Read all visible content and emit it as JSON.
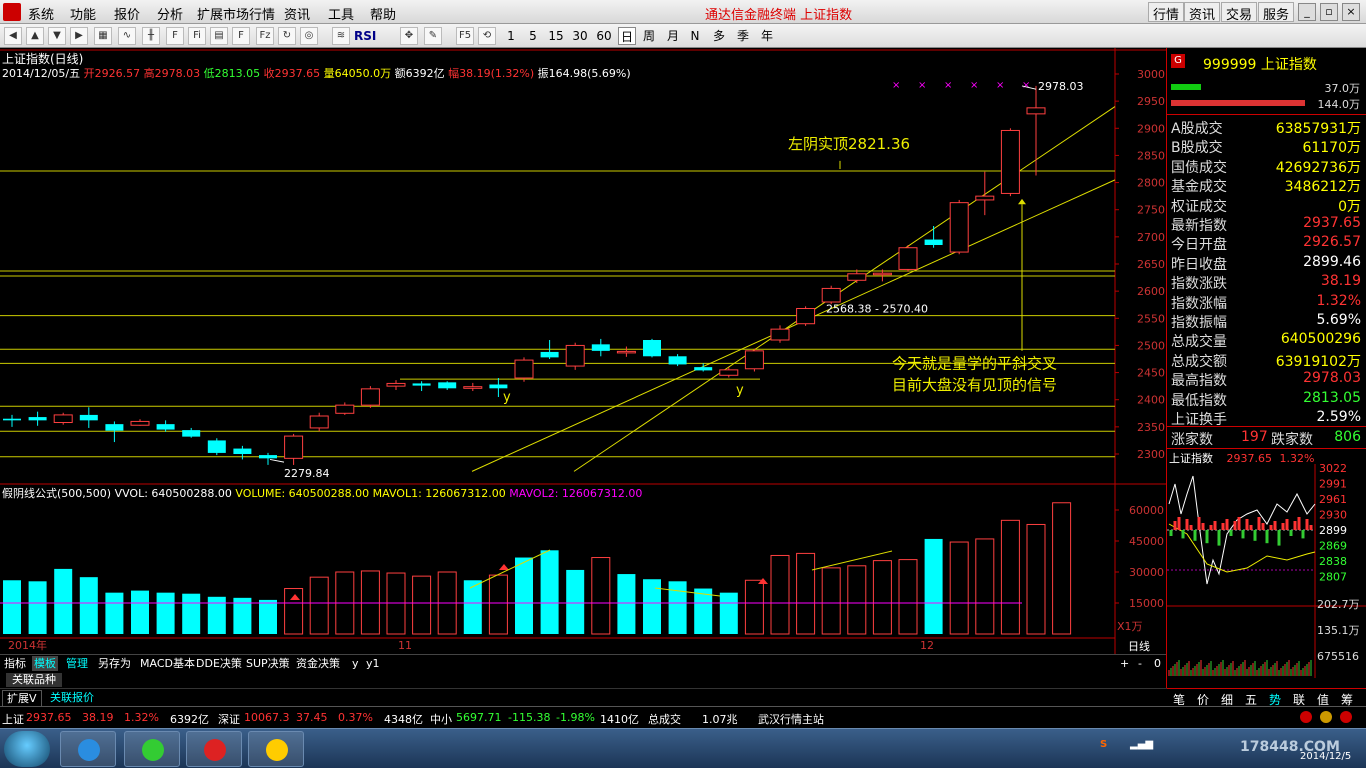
{
  "menu": {
    "items": [
      "系统",
      "功能",
      "报价",
      "分析",
      "扩展市场行情",
      "资讯",
      "工具",
      "帮助"
    ],
    "title": "通达信金融终端   上证指数",
    "right_buttons": [
      "行情",
      "资讯",
      "交易",
      "服务"
    ]
  },
  "toolbar": {
    "periods": [
      "1",
      "5",
      "15",
      "30",
      "60",
      "日",
      "周",
      "月",
      "N",
      "多",
      "季",
      "年"
    ],
    "active_period": "日",
    "indicator_label": "RSI"
  },
  "chart_info": {
    "title": "上证指数(日线)",
    "date": "2014/12/05/五",
    "open_label": "开",
    "open": "2926.57",
    "high_label": "高",
    "high": "2978.03",
    "low_label": "低",
    "low": "2813.05",
    "close_label": "收",
    "close": "2937.65",
    "vol_label": "量",
    "vol": "64050.0万",
    "amount_label": "额",
    "amount": "6392亿",
    "change_label": "幅",
    "change": "38.19(1.32%)",
    "amp_label": "振",
    "amp": "164.98(5.69%)"
  },
  "annotations": {
    "top_label": "左阴实顶2821.36",
    "range_label": "2568.38 - 2570.40",
    "low_label": "2279.84",
    "high_label": "2978.03",
    "msg1": "今天就是量学的平斜交叉",
    "msg2": "目前大盘没有见顶的信号",
    "y1": "y",
    "y2": "y"
  },
  "volume_info": {
    "name": "假阴线公式(500,500)",
    "vvol": "VVOL: 640500288.00",
    "volume": "VOLUME: 640500288.00",
    "mavol1": "MAVOL1: 126067312.00",
    "mavol2": "MAVOL2: 126067312.00",
    "unit": "X1万"
  },
  "x_axis_labels": [
    "2014年",
    "11",
    "12"
  ],
  "chart_data": {
    "type": "candlestick",
    "y_ticks": [
      "3000",
      "2950",
      "2900",
      "2850",
      "2800",
      "2750",
      "2700",
      "2650",
      "2600",
      "2550",
      "2500",
      "2450",
      "2400",
      "2350",
      "2300"
    ],
    "ylim": [
      2270,
      3010
    ],
    "vol_ticks": [
      "60000",
      "45000",
      "30000",
      "15000"
    ],
    "candles": [
      {
        "o": 2365,
        "c": 2362,
        "h": 2372,
        "l": 2350,
        "up": false
      },
      {
        "o": 2368,
        "c": 2362,
        "h": 2378,
        "l": 2352,
        "up": false
      },
      {
        "o": 2358,
        "c": 2372,
        "h": 2376,
        "l": 2354,
        "up": true
      },
      {
        "o": 2372,
        "c": 2362,
        "h": 2386,
        "l": 2348,
        "up": false
      },
      {
        "o": 2355,
        "c": 2343,
        "h": 2360,
        "l": 2322,
        "up": false
      },
      {
        "o": 2353,
        "c": 2360,
        "h": 2364,
        "l": 2352,
        "up": true
      },
      {
        "o": 2355,
        "c": 2345,
        "h": 2362,
        "l": 2341,
        "up": false
      },
      {
        "o": 2344,
        "c": 2332,
        "h": 2348,
        "l": 2330,
        "up": false
      },
      {
        "o": 2325,
        "c": 2302,
        "h": 2329,
        "l": 2298,
        "up": false
      },
      {
        "o": 2310,
        "c": 2300,
        "h": 2315,
        "l": 2290,
        "up": false
      },
      {
        "o": 2298,
        "c": 2292,
        "h": 2302,
        "l": 2280,
        "up": false
      },
      {
        "o": 2292,
        "c": 2333,
        "h": 2337,
        "l": 2279.84,
        "up": true
      },
      {
        "o": 2348,
        "c": 2370,
        "h": 2376,
        "l": 2342,
        "up": true
      },
      {
        "o": 2375,
        "c": 2390,
        "h": 2395,
        "l": 2372,
        "up": true
      },
      {
        "o": 2390,
        "c": 2420,
        "h": 2425,
        "l": 2385,
        "up": true
      },
      {
        "o": 2425,
        "c": 2430,
        "h": 2436,
        "l": 2418,
        "up": true
      },
      {
        "o": 2430,
        "c": 2426,
        "h": 2434,
        "l": 2416,
        "up": false
      },
      {
        "o": 2432,
        "c": 2421,
        "h": 2434,
        "l": 2418,
        "up": false
      },
      {
        "o": 2421,
        "c": 2424,
        "h": 2431,
        "l": 2416,
        "up": true
      },
      {
        "o": 2428,
        "c": 2421,
        "h": 2440,
        "l": 2405,
        "up": false
      },
      {
        "o": 2440,
        "c": 2473,
        "h": 2478,
        "l": 2433,
        "up": true
      },
      {
        "o": 2488,
        "c": 2478,
        "h": 2510,
        "l": 2475,
        "up": false
      },
      {
        "o": 2462,
        "c": 2500,
        "h": 2505,
        "l": 2455,
        "up": true
      },
      {
        "o": 2502,
        "c": 2490,
        "h": 2512,
        "l": 2480,
        "up": false
      },
      {
        "o": 2488,
        "c": 2489,
        "h": 2498,
        "l": 2479,
        "up": true
      },
      {
        "o": 2510,
        "c": 2480,
        "h": 2512,
        "l": 2478,
        "up": false
      },
      {
        "o": 2480,
        "c": 2465,
        "h": 2484,
        "l": 2462,
        "up": false
      },
      {
        "o": 2460,
        "c": 2454,
        "h": 2467,
        "l": 2452,
        "up": false
      },
      {
        "o": 2445,
        "c": 2455,
        "h": 2460,
        "l": 2441,
        "up": true
      },
      {
        "o": 2457,
        "c": 2490,
        "h": 2494,
        "l": 2452,
        "up": true
      },
      {
        "o": 2510,
        "c": 2530,
        "h": 2537,
        "l": 2505,
        "up": true
      },
      {
        "o": 2540,
        "c": 2568,
        "h": 2572,
        "l": 2536,
        "up": true
      },
      {
        "o": 2580,
        "c": 2605,
        "h": 2610,
        "l": 2576,
        "up": true
      },
      {
        "o": 2620,
        "c": 2632,
        "h": 2640,
        "l": 2615,
        "up": true
      },
      {
        "o": 2633,
        "c": 2632,
        "h": 2640,
        "l": 2618,
        "up": true
      },
      {
        "o": 2640,
        "c": 2680,
        "h": 2685,
        "l": 2636,
        "up": true
      },
      {
        "o": 2695,
        "c": 2685,
        "h": 2720,
        "l": 2680,
        "up": false
      },
      {
        "o": 2672,
        "c": 2763,
        "h": 2768,
        "l": 2668,
        "up": true
      },
      {
        "o": 2768,
        "c": 2775,
        "h": 2820,
        "l": 2740,
        "up": true
      },
      {
        "o": 2780,
        "c": 2896,
        "h": 2900,
        "l": 2775,
        "up": true
      },
      {
        "o": 2926.57,
        "c": 2937.65,
        "h": 2978.03,
        "l": 2813.05,
        "up": true
      }
    ],
    "volumes": [
      26000,
      25500,
      31500,
      27500,
      20000,
      21000,
      20000,
      19500,
      18000,
      17500,
      16500,
      22000,
      27500,
      30000,
      30500,
      29500,
      28000,
      30000,
      26000,
      28500,
      37000,
      40500,
      31000,
      37000,
      29000,
      26500,
      25500,
      22000,
      20000,
      26000,
      38000,
      39000,
      32000,
      33000,
      35500,
      36000,
      46000,
      44500,
      46000,
      55000,
      53000,
      63500
    ],
    "vol_up": [
      false,
      false,
      false,
      false,
      false,
      false,
      false,
      false,
      false,
      false,
      false,
      true,
      true,
      true,
      true,
      true,
      true,
      true,
      false,
      true,
      false,
      false,
      false,
      true,
      false,
      false,
      false,
      false,
      false,
      true,
      true,
      true,
      true,
      true,
      true,
      true,
      false,
      true,
      true,
      true,
      true,
      true
    ]
  },
  "right_panel": {
    "code": "999999 上证指数",
    "bar1": "37.0万",
    "bar2": "144.0万",
    "rows": [
      {
        "label": "A股成交",
        "value": "63857931万",
        "color": "#ffff00"
      },
      {
        "label": "B股成交",
        "value": "61170万",
        "color": "#ffff00"
      },
      {
        "label": "国债成交",
        "value": "42692736万",
        "color": "#ffff00"
      },
      {
        "label": "基金成交",
        "value": "3486212万",
        "color": "#ffff00"
      },
      {
        "label": "权证成交",
        "value": "0万",
        "color": "#ffff00"
      },
      {
        "label": "最新指数",
        "value": "2937.65",
        "color": "#ff3333"
      },
      {
        "label": "今日开盘",
        "value": "2926.57",
        "color": "#ff3333"
      },
      {
        "label": "昨日收盘",
        "value": "2899.46",
        "color": "#ffffff"
      },
      {
        "label": "指数涨跌",
        "value": "38.19",
        "color": "#ff3333"
      },
      {
        "label": "指数涨幅",
        "value": "1.32%",
        "color": "#ff3333"
      },
      {
        "label": "指数振幅",
        "value": "5.69%",
        "color": "#ffffff"
      },
      {
        "label": "总成交量",
        "value": "640500296",
        "color": "#ffff00"
      },
      {
        "label": "总成交额",
        "value": "63919102万",
        "color": "#ffff00"
      },
      {
        "label": "最高指数",
        "value": "2978.03",
        "color": "#ff3333"
      },
      {
        "label": "最低指数",
        "value": "2813.05",
        "color": "#33ff33"
      },
      {
        "label": "上证换手",
        "value": "2.59%",
        "color": "#ffffff"
      }
    ],
    "rise_label": "涨家数",
    "rise": "197",
    "fall_label": "跌家数",
    "fall": "806",
    "mini_title": "上证指数",
    "mini_price": "2937.65",
    "mini_pct": "1.32%",
    "mini_ticks": [
      "3022",
      "2991",
      "2961",
      "2930",
      "2899",
      "2869",
      "2838",
      "2807"
    ],
    "mini_pcts": [
      "202.7万",
      "135.1万",
      "675516"
    ],
    "tabs": [
      "笔",
      "价",
      "细",
      "五",
      "势",
      "联",
      "值",
      "筹"
    ]
  },
  "bottom_tabs": [
    "指标",
    "模板",
    "管理",
    "另存为",
    "MACD基本",
    "DDE决策",
    "SUP决策",
    "资金决策",
    "y",
    "y1"
  ],
  "period_tab": "日线",
  "link_tab": "关联品种",
  "ext_tabs": [
    "扩展V",
    "关联报价"
  ],
  "status": {
    "sh_label": "上证",
    "sh": "2937.65",
    "sh_chg": "38.19",
    "sh_pct": "1.32%",
    "sh_amt": "6392亿",
    "sz_label": "深证",
    "sz": "10067.3",
    "sz_chg": "37.45",
    "sz_pct": "0.37%",
    "sz_amt": "4348亿",
    "zx_label": "中小",
    "zx": "5697.71",
    "zx_chg": "-115.38",
    "zx_pct": "-1.98%",
    "zx_amt": "1410亿",
    "total_label": "总成交",
    "total": "1.07兆",
    "station": "武汉行情主站"
  },
  "taskbar": {
    "clock_date": "2014/12/5",
    "watermark": "178448.COM"
  }
}
